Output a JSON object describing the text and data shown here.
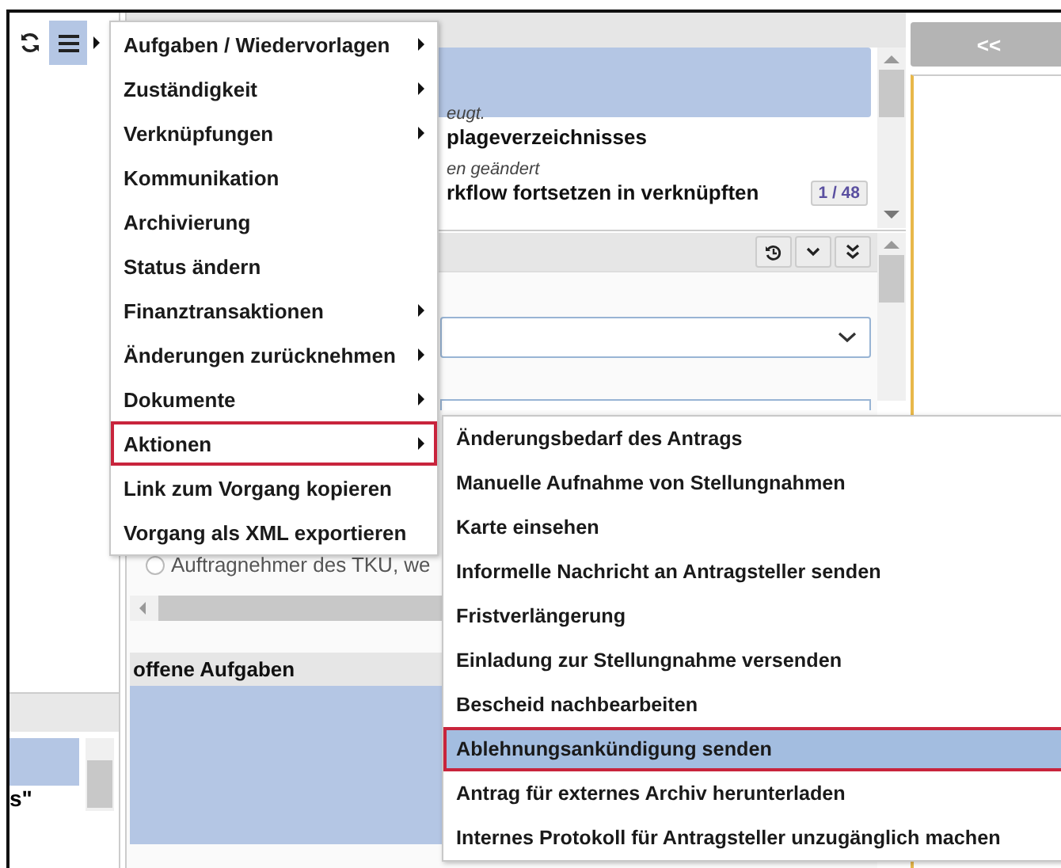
{
  "toolbar": {
    "menu_button": {
      "selected": true
    }
  },
  "main_menu": [
    {
      "label": "Aufgaben / Wiedervorlagen",
      "has_submenu": true,
      "selected": false
    },
    {
      "label": "Zuständigkeit",
      "has_submenu": true,
      "selected": false
    },
    {
      "label": "Verknüpfungen",
      "has_submenu": true,
      "selected": false
    },
    {
      "label": "Kommunikation",
      "has_submenu": false,
      "selected": false
    },
    {
      "label": "Archivierung",
      "has_submenu": false,
      "selected": false
    },
    {
      "label": "Status ändern",
      "has_submenu": false,
      "selected": false
    },
    {
      "label": "Finanztransaktionen",
      "has_submenu": true,
      "selected": false
    },
    {
      "label": "Änderungen zurücknehmen",
      "has_submenu": true,
      "selected": false
    },
    {
      "label": "Dokumente",
      "has_submenu": true,
      "selected": false
    },
    {
      "label": "Aktionen",
      "has_submenu": true,
      "selected": true
    },
    {
      "label": "Link zum Vorgang kopieren",
      "has_submenu": false,
      "selected": false
    },
    {
      "label": "Vorgang als XML exportieren",
      "has_submenu": false,
      "selected": false
    }
  ],
  "submenu": [
    {
      "label": "Änderungsbedarf des Antrags",
      "selected": false
    },
    {
      "label": "Manuelle Aufnahme von Stellungnahmen",
      "selected": false
    },
    {
      "label": "Karte einsehen",
      "selected": false
    },
    {
      "label": "Informelle Nachricht an Antragsteller senden",
      "selected": false
    },
    {
      "label": "Fristverlängerung",
      "selected": false
    },
    {
      "label": "Einladung zur Stellungnahme versenden",
      "selected": false
    },
    {
      "label": "Bescheid nachbearbeiten",
      "selected": false
    },
    {
      "label": "Ablehnungsankündigung senden",
      "selected": true
    },
    {
      "label": "Antrag für externes Archiv herunterladen",
      "selected": false
    },
    {
      "label": "Internes Protokoll für Antragsteller unzugänglich machen",
      "selected": false
    }
  ],
  "history_list": {
    "entries": [
      {
        "note": "eugt.",
        "title": "plageverzeichnisses"
      },
      {
        "note": "en geändert",
        "title": "rkflow fortsetzen in verknüpften"
      }
    ],
    "counter": "1 / 48"
  },
  "form": {
    "radio": {
      "label": "Auftragnehmer des TKU, we",
      "selected": false
    }
  },
  "tasks_panel": {
    "title": "offene Aufgaben"
  },
  "left_panel": {
    "row_text": "s\""
  },
  "right_panel": {
    "collapse_button": "<<"
  }
}
